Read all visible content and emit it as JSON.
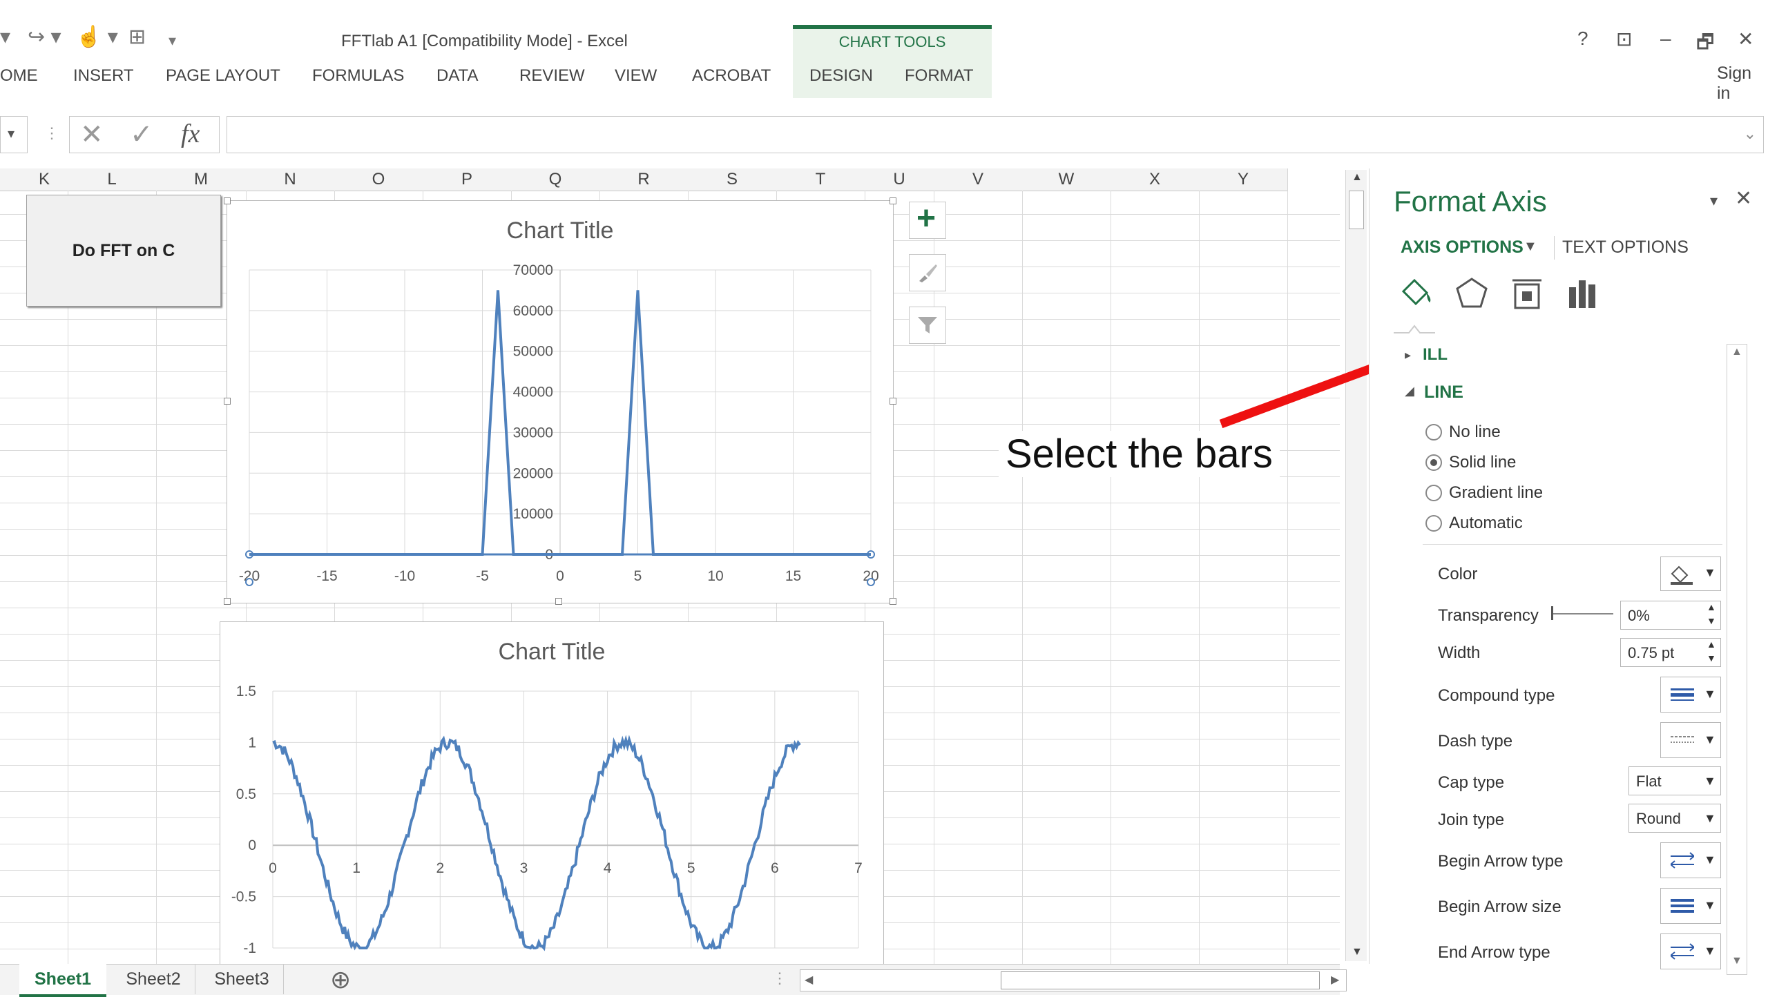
{
  "qat": {
    "undo": "▾",
    "redo": "↪ ▾",
    "touch": "☝ ▾",
    "filter": "⊞",
    "more": "▾"
  },
  "window": {
    "title": "FFTlab A1  [Compatibility Mode] - Excel",
    "help": "?",
    "restore_ribbon": "⊡",
    "minimize": "–",
    "maximize": "🗗",
    "close": "✕",
    "sign_in": "Sign in"
  },
  "ribbon": {
    "tabs": [
      "OME",
      "INSERT",
      "PAGE LAYOUT",
      "FORMULAS",
      "DATA",
      "REVIEW",
      "VIEW",
      "ACROBAT"
    ],
    "context_title": "CHART TOOLS",
    "context_tabs": [
      "DESIGN",
      "FORMAT"
    ]
  },
  "formula_bar": {
    "cancel": "✕",
    "enter": "✓",
    "fx": "fx",
    "value": ""
  },
  "columns": [
    "K",
    "L",
    "M",
    "N",
    "O",
    "P",
    "Q",
    "R",
    "S",
    "T",
    "U",
    "V",
    "W",
    "X",
    "Y"
  ],
  "button": {
    "label": "Do FFT on C"
  },
  "chart1": {
    "title": "Chart Title"
  },
  "chart2": {
    "title": "Chart Title"
  },
  "chart_data": [
    {
      "type": "line",
      "title": "Chart Title",
      "x": [
        -20,
        -5,
        -4,
        -3,
        -2,
        0,
        2,
        3,
        4,
        5,
        6,
        20
      ],
      "y": [
        0,
        0,
        65000,
        0,
        0,
        0,
        0,
        0,
        0,
        65000,
        0,
        0
      ],
      "xlim": [
        -20,
        20
      ],
      "ylim": [
        0,
        70000
      ],
      "xticks": [
        "-20",
        "-15",
        "-10",
        "-5",
        "0",
        "5",
        "10",
        "15",
        "20"
      ],
      "yticks": [
        "0",
        "10000",
        "20000",
        "30000",
        "40000",
        "50000",
        "60000",
        "70000"
      ],
      "grid": true,
      "color": "#4f81bd"
    },
    {
      "type": "line",
      "title": "Chart Title",
      "x_desc": "sinusoid cos(3x) with noise from 0 to 6.3",
      "xlim": [
        0,
        7
      ],
      "ylim": [
        -1,
        1.5
      ],
      "xticks": [
        "0",
        "1",
        "2",
        "3",
        "4",
        "5",
        "6",
        "7"
      ],
      "yticks": [
        "-1",
        "-0.5",
        "0",
        "0.5",
        "1",
        "1.5"
      ],
      "frequency": 3,
      "amplitude": 1,
      "grid": true,
      "color": "#4f81bd"
    }
  ],
  "chart_buttons": {
    "add": "+",
    "style": "brush-icon",
    "filter": "filter-icon"
  },
  "annotation": {
    "text": "Select the bars",
    "color": "#ee1111"
  },
  "pane": {
    "title": "Format Axis",
    "axis_options": "AXIS OPTIONS",
    "text_options": "TEXT OPTIONS",
    "fill_header": "ILL",
    "line_header": "LINE",
    "line_options": [
      {
        "label": "No line",
        "selected": false
      },
      {
        "label": "Solid line",
        "selected": true
      },
      {
        "label": "Gradient line",
        "selected": false
      },
      {
        "label": "Automatic",
        "selected": false
      }
    ],
    "rows": {
      "color": "Color",
      "transparency": "Transparency",
      "transparency_val": "0%",
      "width": "Width",
      "width_val": "0.75 pt",
      "compound": "Compound type",
      "dash": "Dash type",
      "cap": "Cap type",
      "cap_val": "Flat",
      "join": "Join type",
      "join_val": "Round",
      "begin_arrow_type": "Begin Arrow type",
      "begin_arrow_size": "Begin Arrow size",
      "end_arrow_type": "End Arrow type"
    }
  },
  "sheets": [
    "Sheet1",
    "Sheet2",
    "Sheet3"
  ],
  "add_sheet": "⊕"
}
